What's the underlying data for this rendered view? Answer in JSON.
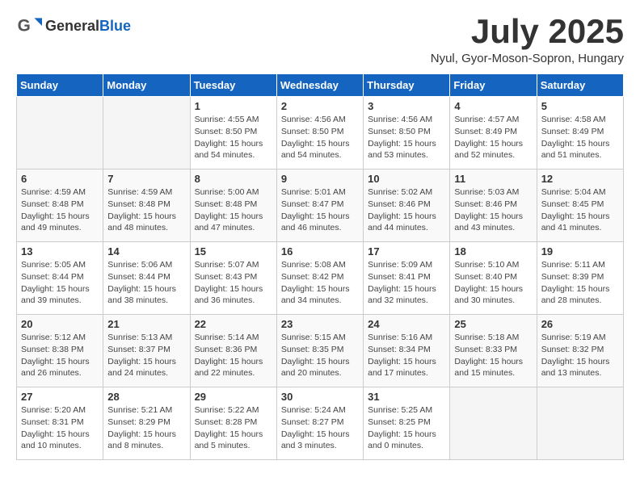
{
  "header": {
    "logo": {
      "general": "General",
      "blue": "Blue"
    },
    "title": "July 2025",
    "location": "Nyul, Gyor-Moson-Sopron, Hungary"
  },
  "weekdays": [
    "Sunday",
    "Monday",
    "Tuesday",
    "Wednesday",
    "Thursday",
    "Friday",
    "Saturday"
  ],
  "weeks": [
    [
      {
        "day": "",
        "empty": true
      },
      {
        "day": "",
        "empty": true
      },
      {
        "day": "1",
        "sunrise": "Sunrise: 4:55 AM",
        "sunset": "Sunset: 8:50 PM",
        "daylight": "Daylight: 15 hours and 54 minutes."
      },
      {
        "day": "2",
        "sunrise": "Sunrise: 4:56 AM",
        "sunset": "Sunset: 8:50 PM",
        "daylight": "Daylight: 15 hours and 54 minutes."
      },
      {
        "day": "3",
        "sunrise": "Sunrise: 4:56 AM",
        "sunset": "Sunset: 8:50 PM",
        "daylight": "Daylight: 15 hours and 53 minutes."
      },
      {
        "day": "4",
        "sunrise": "Sunrise: 4:57 AM",
        "sunset": "Sunset: 8:49 PM",
        "daylight": "Daylight: 15 hours and 52 minutes."
      },
      {
        "day": "5",
        "sunrise": "Sunrise: 4:58 AM",
        "sunset": "Sunset: 8:49 PM",
        "daylight": "Daylight: 15 hours and 51 minutes."
      }
    ],
    [
      {
        "day": "6",
        "sunrise": "Sunrise: 4:59 AM",
        "sunset": "Sunset: 8:48 PM",
        "daylight": "Daylight: 15 hours and 49 minutes."
      },
      {
        "day": "7",
        "sunrise": "Sunrise: 4:59 AM",
        "sunset": "Sunset: 8:48 PM",
        "daylight": "Daylight: 15 hours and 48 minutes."
      },
      {
        "day": "8",
        "sunrise": "Sunrise: 5:00 AM",
        "sunset": "Sunset: 8:48 PM",
        "daylight": "Daylight: 15 hours and 47 minutes."
      },
      {
        "day": "9",
        "sunrise": "Sunrise: 5:01 AM",
        "sunset": "Sunset: 8:47 PM",
        "daylight": "Daylight: 15 hours and 46 minutes."
      },
      {
        "day": "10",
        "sunrise": "Sunrise: 5:02 AM",
        "sunset": "Sunset: 8:46 PM",
        "daylight": "Daylight: 15 hours and 44 minutes."
      },
      {
        "day": "11",
        "sunrise": "Sunrise: 5:03 AM",
        "sunset": "Sunset: 8:46 PM",
        "daylight": "Daylight: 15 hours and 43 minutes."
      },
      {
        "day": "12",
        "sunrise": "Sunrise: 5:04 AM",
        "sunset": "Sunset: 8:45 PM",
        "daylight": "Daylight: 15 hours and 41 minutes."
      }
    ],
    [
      {
        "day": "13",
        "sunrise": "Sunrise: 5:05 AM",
        "sunset": "Sunset: 8:44 PM",
        "daylight": "Daylight: 15 hours and 39 minutes."
      },
      {
        "day": "14",
        "sunrise": "Sunrise: 5:06 AM",
        "sunset": "Sunset: 8:44 PM",
        "daylight": "Daylight: 15 hours and 38 minutes."
      },
      {
        "day": "15",
        "sunrise": "Sunrise: 5:07 AM",
        "sunset": "Sunset: 8:43 PM",
        "daylight": "Daylight: 15 hours and 36 minutes."
      },
      {
        "day": "16",
        "sunrise": "Sunrise: 5:08 AM",
        "sunset": "Sunset: 8:42 PM",
        "daylight": "Daylight: 15 hours and 34 minutes."
      },
      {
        "day": "17",
        "sunrise": "Sunrise: 5:09 AM",
        "sunset": "Sunset: 8:41 PM",
        "daylight": "Daylight: 15 hours and 32 minutes."
      },
      {
        "day": "18",
        "sunrise": "Sunrise: 5:10 AM",
        "sunset": "Sunset: 8:40 PM",
        "daylight": "Daylight: 15 hours and 30 minutes."
      },
      {
        "day": "19",
        "sunrise": "Sunrise: 5:11 AM",
        "sunset": "Sunset: 8:39 PM",
        "daylight": "Daylight: 15 hours and 28 minutes."
      }
    ],
    [
      {
        "day": "20",
        "sunrise": "Sunrise: 5:12 AM",
        "sunset": "Sunset: 8:38 PM",
        "daylight": "Daylight: 15 hours and 26 minutes."
      },
      {
        "day": "21",
        "sunrise": "Sunrise: 5:13 AM",
        "sunset": "Sunset: 8:37 PM",
        "daylight": "Daylight: 15 hours and 24 minutes."
      },
      {
        "day": "22",
        "sunrise": "Sunrise: 5:14 AM",
        "sunset": "Sunset: 8:36 PM",
        "daylight": "Daylight: 15 hours and 22 minutes."
      },
      {
        "day": "23",
        "sunrise": "Sunrise: 5:15 AM",
        "sunset": "Sunset: 8:35 PM",
        "daylight": "Daylight: 15 hours and 20 minutes."
      },
      {
        "day": "24",
        "sunrise": "Sunrise: 5:16 AM",
        "sunset": "Sunset: 8:34 PM",
        "daylight": "Daylight: 15 hours and 17 minutes."
      },
      {
        "day": "25",
        "sunrise": "Sunrise: 5:18 AM",
        "sunset": "Sunset: 8:33 PM",
        "daylight": "Daylight: 15 hours and 15 minutes."
      },
      {
        "day": "26",
        "sunrise": "Sunrise: 5:19 AM",
        "sunset": "Sunset: 8:32 PM",
        "daylight": "Daylight: 15 hours and 13 minutes."
      }
    ],
    [
      {
        "day": "27",
        "sunrise": "Sunrise: 5:20 AM",
        "sunset": "Sunset: 8:31 PM",
        "daylight": "Daylight: 15 hours and 10 minutes."
      },
      {
        "day": "28",
        "sunrise": "Sunrise: 5:21 AM",
        "sunset": "Sunset: 8:29 PM",
        "daylight": "Daylight: 15 hours and 8 minutes."
      },
      {
        "day": "29",
        "sunrise": "Sunrise: 5:22 AM",
        "sunset": "Sunset: 8:28 PM",
        "daylight": "Daylight: 15 hours and 5 minutes."
      },
      {
        "day": "30",
        "sunrise": "Sunrise: 5:24 AM",
        "sunset": "Sunset: 8:27 PM",
        "daylight": "Daylight: 15 hours and 3 minutes."
      },
      {
        "day": "31",
        "sunrise": "Sunrise: 5:25 AM",
        "sunset": "Sunset: 8:25 PM",
        "daylight": "Daylight: 15 hours and 0 minutes."
      },
      {
        "day": "",
        "empty": true
      },
      {
        "day": "",
        "empty": true
      }
    ]
  ]
}
